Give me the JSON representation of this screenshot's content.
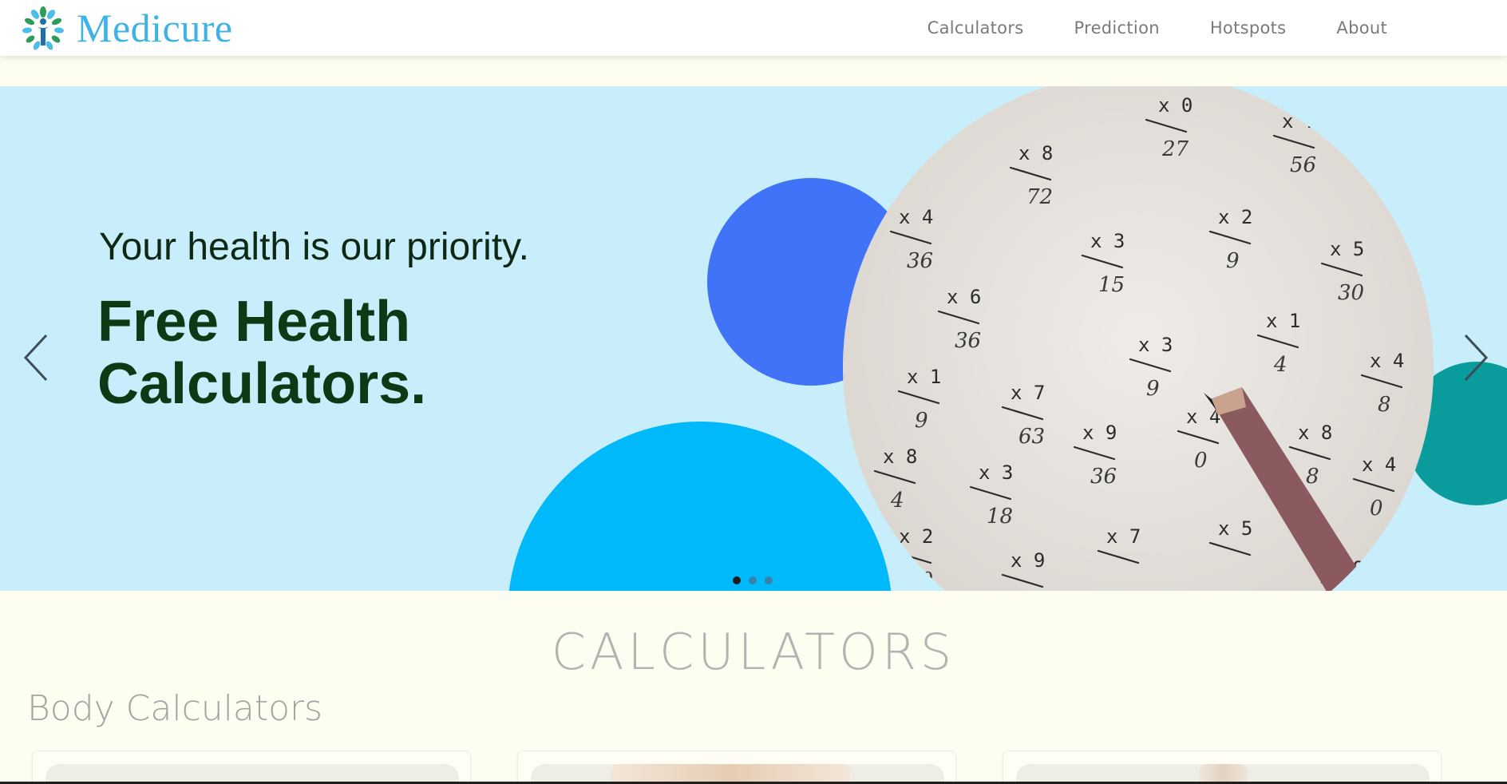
{
  "brand": {
    "name": "Medicure",
    "logo_icon": "tree-person-logo-icon",
    "color": "#3fb2e6"
  },
  "nav": {
    "links": [
      {
        "label": "Calculators"
      },
      {
        "label": "Prediction"
      },
      {
        "label": "Hotspots"
      },
      {
        "label": "About"
      }
    ]
  },
  "carousel": {
    "subtitle": "Your health is our priority.",
    "title": "Free Health Calculators.",
    "prev_icon": "chevron-left-icon",
    "next_icon": "chevron-right-icon",
    "slide_count": 3,
    "active_slide": 1,
    "colors": {
      "background": "#c8eefc",
      "blue": "#4173f8",
      "cyan": "#00b9fb",
      "teal": "#0a9b9c",
      "title": "#0d3a14"
    }
  },
  "calculators": {
    "heading": "CALCULATORS",
    "section": "Body Calculators",
    "cards": [
      {},
      {},
      {}
    ]
  }
}
